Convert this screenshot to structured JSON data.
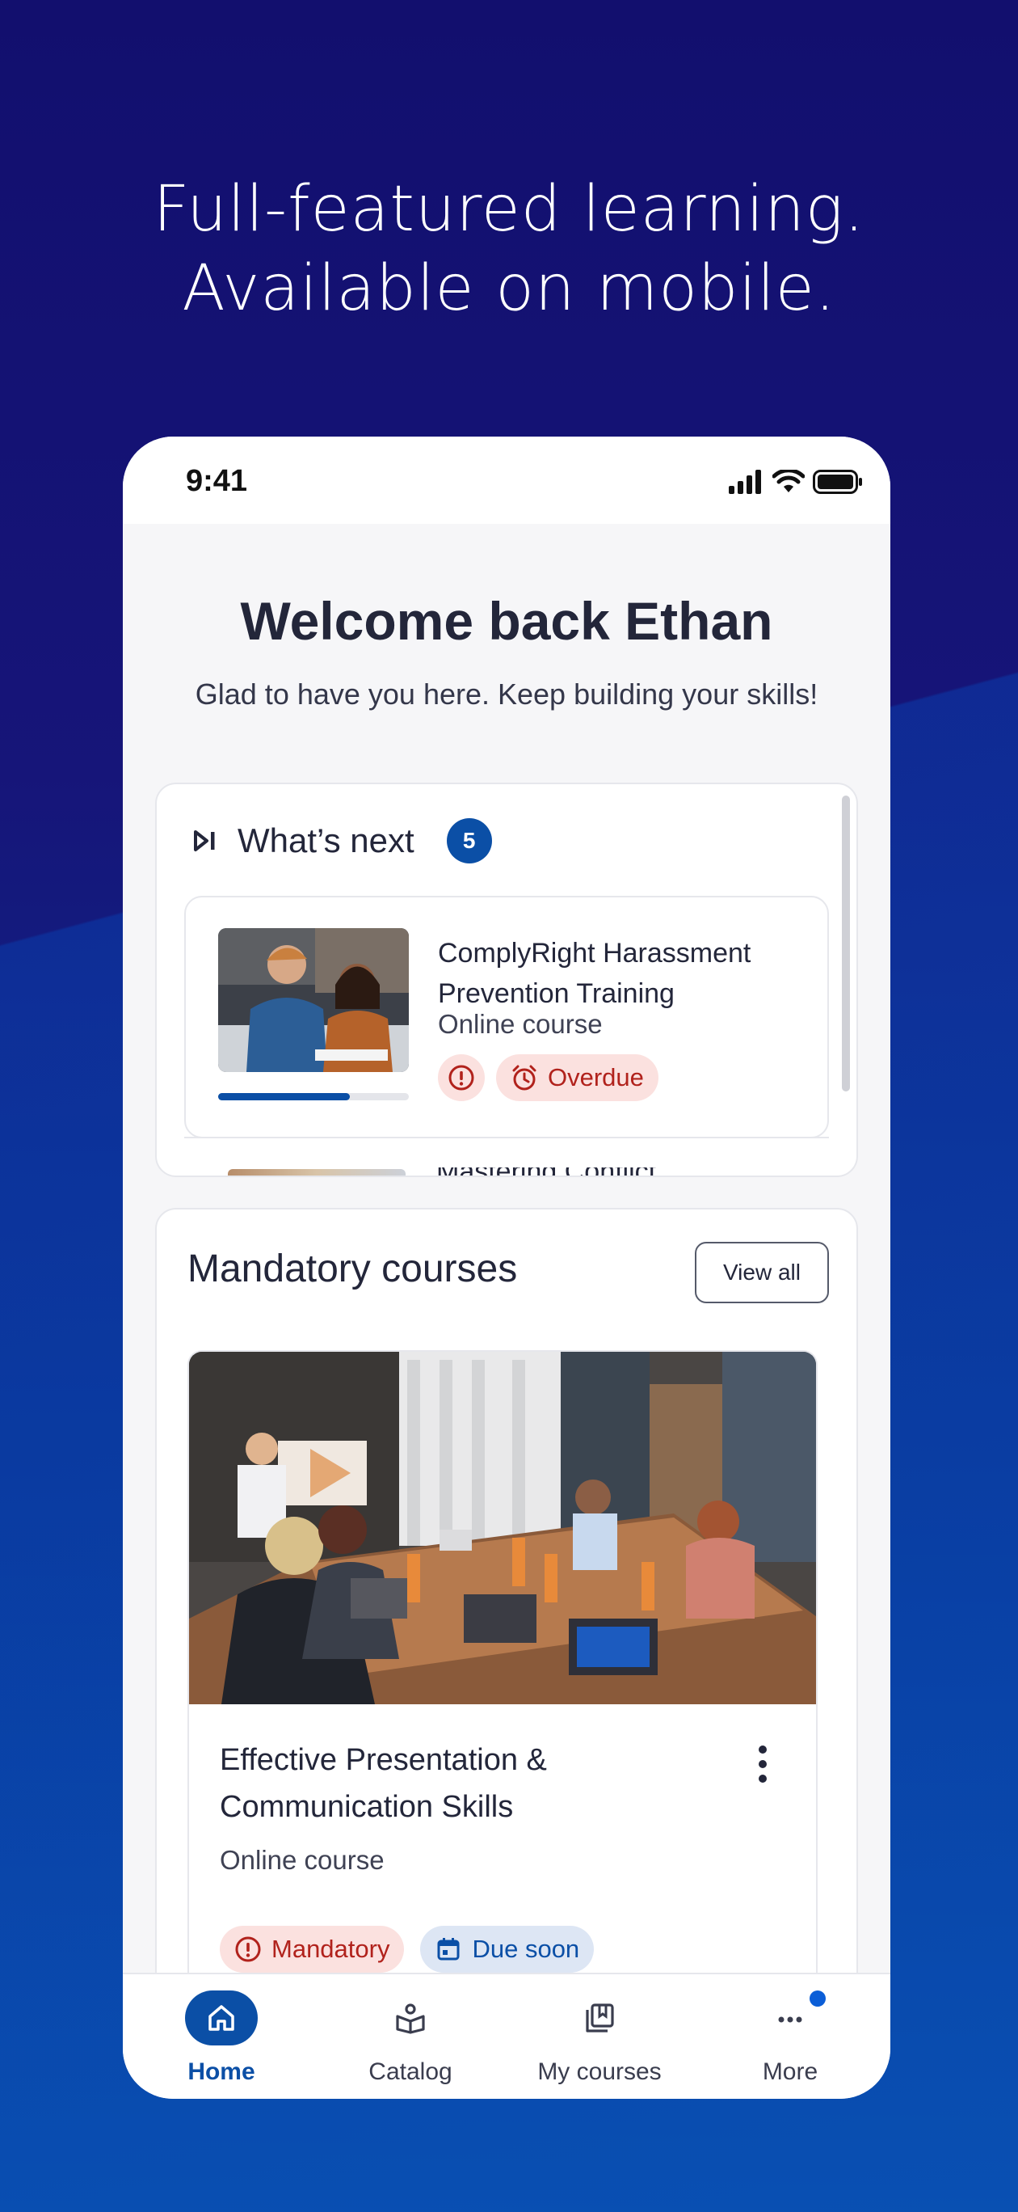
{
  "headline": {
    "line1": "Full-featured learning.",
    "line2": "Available on mobile."
  },
  "status_bar": {
    "time": "9:41",
    "icons": [
      "signal-icon",
      "wifi-icon",
      "battery-icon"
    ]
  },
  "welcome": {
    "title": "Welcome back Ethan",
    "subtitle": "Glad to have you here. Keep building your skills!"
  },
  "whats_next": {
    "icon": "skip-next-icon",
    "title": "What’s next",
    "count": "5",
    "items": [
      {
        "title": "ComplyRight Harassment Prevention Training",
        "type": "Online course",
        "progress": 0.69,
        "chips": [
          {
            "icon": "alert-icon",
            "label": ""
          },
          {
            "icon": "alarm-icon",
            "label": "Overdue"
          }
        ]
      },
      {
        "title": "Mastering Conflict"
      }
    ]
  },
  "mandatory": {
    "title": "Mandatory courses",
    "view_all_label": "View all",
    "course": {
      "title": "Effective Presentation & Communication Skills",
      "type": "Online course",
      "chips": [
        {
          "icon": "alert-icon",
          "label": "Mandatory"
        },
        {
          "icon": "calendar-icon",
          "label": "Due soon"
        }
      ]
    }
  },
  "nav": {
    "items": [
      {
        "label": "Home",
        "icon": "home-icon",
        "active": true
      },
      {
        "label": "Catalog",
        "icon": "catalog-icon"
      },
      {
        "label": "My courses",
        "icon": "my-courses-icon"
      },
      {
        "label": "More",
        "icon": "more-icon",
        "has_notification": true
      }
    ]
  },
  "colors": {
    "brand": "#0b4fa6",
    "danger": "#b1221c",
    "danger_bg": "#fbe1df",
    "info_bg": "#dde6f4"
  }
}
